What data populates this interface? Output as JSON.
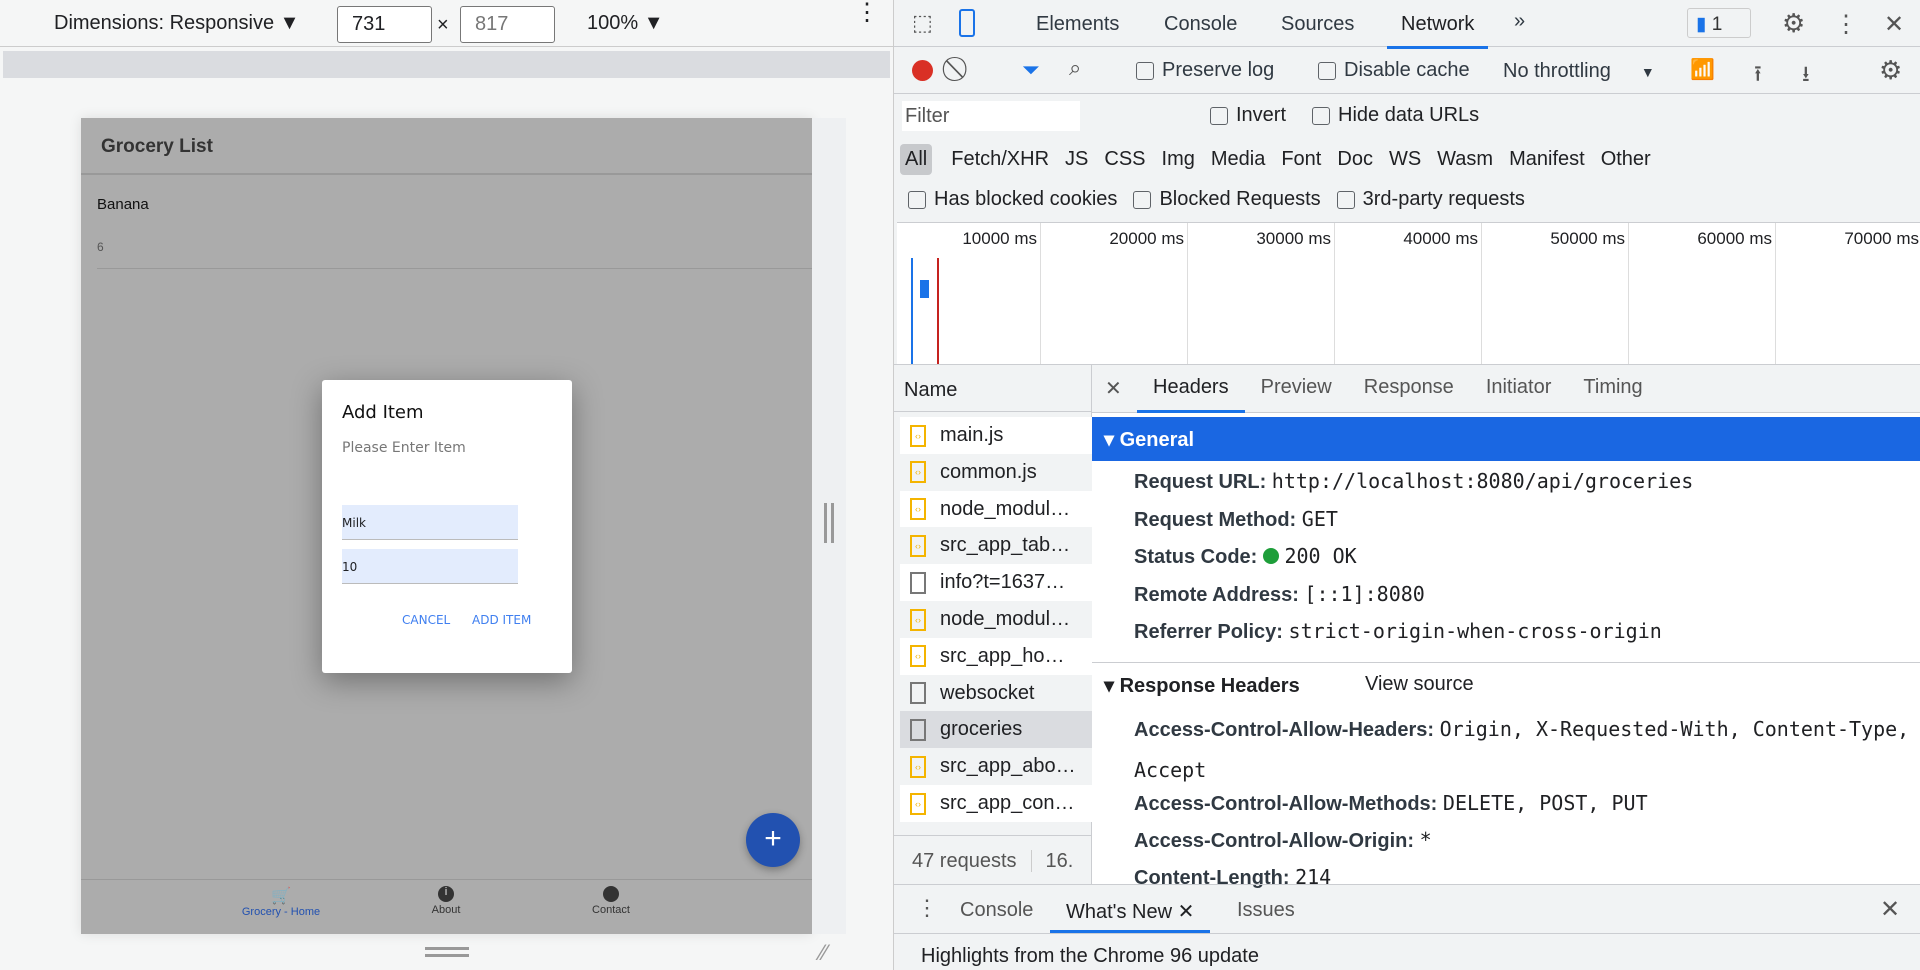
{
  "device_toolbar": {
    "dimensions_label": "Dimensions: Responsive ▼",
    "width": "731",
    "x": "×",
    "height": "817",
    "zoom": "100% ▼"
  },
  "app": {
    "title": "Grocery List",
    "items": [
      {
        "name": "Banana",
        "qty": "6"
      }
    ],
    "dialog": {
      "title": "Add Item",
      "subtitle": "Please Enter Item",
      "name_value": "Milk",
      "qty_value": "10",
      "cancel": "CANCEL",
      "add": "ADD ITEM"
    },
    "fab": "+",
    "nav": [
      {
        "label": "Grocery - Home",
        "icon": "cart-icon"
      },
      {
        "label": "About",
        "icon": "info-icon"
      },
      {
        "label": "Contact",
        "icon": "contact-icon"
      }
    ]
  },
  "devtools": {
    "tabs": [
      "Elements",
      "Console",
      "Sources",
      "Network"
    ],
    "more": "»",
    "issues_count": "1",
    "toolbar": {
      "preserve_log": "Preserve log",
      "disable_cache": "Disable cache",
      "throttling": "No throttling"
    },
    "filter_placeholder": "Filter",
    "invert": "Invert",
    "hide_data_urls": "Hide data URLs",
    "types": [
      "All",
      "Fetch/XHR",
      "JS",
      "CSS",
      "Img",
      "Media",
      "Font",
      "Doc",
      "WS",
      "Wasm",
      "Manifest",
      "Other"
    ],
    "blocked": [
      "Has blocked cookies",
      "Blocked Requests",
      "3rd-party requests"
    ],
    "timeline_ticks": [
      "10000 ms",
      "20000 ms",
      "30000 ms",
      "40000 ms",
      "50000 ms",
      "60000 ms",
      "70000 ms"
    ],
    "name_header": "Name",
    "requests": [
      {
        "name": "main.js",
        "type": "script"
      },
      {
        "name": "common.js",
        "type": "script"
      },
      {
        "name": "node_modul…",
        "type": "script"
      },
      {
        "name": "src_app_tab…",
        "type": "script"
      },
      {
        "name": "info?t=1637…",
        "type": "doc"
      },
      {
        "name": "node_modul…",
        "type": "script"
      },
      {
        "name": "src_app_ho…",
        "type": "script"
      },
      {
        "name": "websocket",
        "type": "doc"
      },
      {
        "name": "groceries",
        "type": "doc"
      },
      {
        "name": "src_app_abo…",
        "type": "script"
      },
      {
        "name": "src_app_con…",
        "type": "script"
      }
    ],
    "summary": "47 requests",
    "summary2": "16.",
    "detail_tabs": [
      "Headers",
      "Preview",
      "Response",
      "Initiator",
      "Timing"
    ],
    "general_title": "General",
    "general": [
      {
        "k": "Request URL:",
        "v": "http://localhost:8080/api/groceries"
      },
      {
        "k": "Request Method:",
        "v": "GET"
      },
      {
        "k": "Status Code:",
        "v": "200 OK"
      },
      {
        "k": "Remote Address:",
        "v": "[::1]:8080"
      },
      {
        "k": "Referrer Policy:",
        "v": "strict-origin-when-cross-origin"
      }
    ],
    "response_title": "Response Headers",
    "view_source": "View source",
    "response": [
      {
        "k": "Access-Control-Allow-Headers:",
        "v": "Origin, X-Requested-With, Content-Type,",
        "v2": "Accept"
      },
      {
        "k": "Access-Control-Allow-Methods:",
        "v": "DELETE, POST, PUT"
      },
      {
        "k": "Access-Control-Allow-Origin:",
        "v": "*"
      },
      {
        "k": "Content-Length:",
        "v": "214"
      }
    ],
    "drawer_tabs": [
      "Console",
      "What's New",
      "Issues"
    ],
    "drawer_text": "Highlights from the Chrome 96 update"
  }
}
